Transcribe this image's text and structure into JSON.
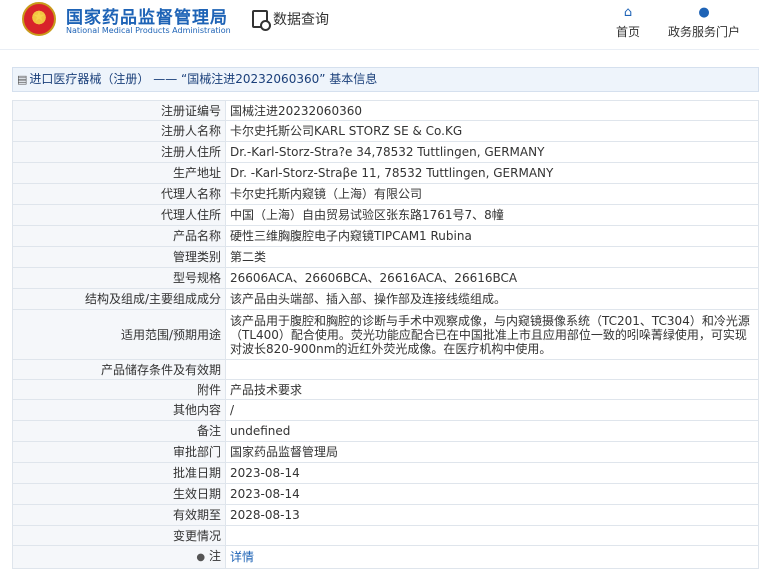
{
  "header": {
    "org_name_cn": "国家药品监督管理局",
    "org_name_en": "National Medical Products Administration",
    "query_label": "数据查询",
    "nav": [
      {
        "label": "首页",
        "icon": "home-icon"
      },
      {
        "label": "政务服务门户",
        "icon": "user-icon"
      }
    ]
  },
  "page": {
    "title": "进口医疗器械（注册） —— “国械注进20232060360” 基本信息"
  },
  "rows": [
    {
      "label": "注册证编号",
      "value": "国械注进20232060360"
    },
    {
      "label": "注册人名称",
      "value": "卡尔史托斯公司KARL STORZ SE & Co.KG"
    },
    {
      "label": "注册人住所",
      "value": "Dr.-Karl-Storz-Stra?e 34,78532 Tuttlingen, GERMANY"
    },
    {
      "label": "生产地址",
      "value": "Dr. -Karl-Storz-Straβe 11, 78532 Tuttlingen, GERMANY"
    },
    {
      "label": "代理人名称",
      "value": "卡尔史托斯内窥镜（上海）有限公司"
    },
    {
      "label": "代理人住所",
      "value": "中国（上海）自由贸易试验区张东路1761号7、8幢"
    },
    {
      "label": "产品名称",
      "value": "硬性三维胸腹腔电子内窥镜TIPCAM1 Rubina"
    },
    {
      "label": "管理类别",
      "value": "第二类"
    },
    {
      "label": "型号规格",
      "value": "26606ACA、26606BCA、26616ACA、26616BCA"
    },
    {
      "label": "结构及组成/主要组成成分",
      "value": "该产品由头端部、插入部、操作部及连接线缆组成。"
    },
    {
      "label": "适用范围/预期用途",
      "value": "该产品用于腹腔和胸腔的诊断与手术中观察成像，与内窥镜摄像系统（TC201、TC304）和冷光源（TL400）配合使用。荧光功能应配合已在中国批准上市且应用部位一致的吲哚菁绿使用，可实现对波长820-900nm的近红外荧光成像。在医疗机构中使用。"
    },
    {
      "label": "产品储存条件及有效期",
      "value": ""
    },
    {
      "label": "附件",
      "value": "产品技术要求"
    },
    {
      "label": "其他内容",
      "value": "/"
    },
    {
      "label": "备注",
      "value": "undefined"
    },
    {
      "label": "审批部门",
      "value": "国家药品监督管理局"
    },
    {
      "label": "批准日期",
      "value": "2023-08-14"
    },
    {
      "label": "生效日期",
      "value": "2023-08-14"
    },
    {
      "label": "有效期至",
      "value": "2028-08-13"
    },
    {
      "label": "变更情况",
      "value": ""
    }
  ],
  "note_row": {
    "label": "注",
    "link": "详情",
    "icon": "info-icon"
  }
}
